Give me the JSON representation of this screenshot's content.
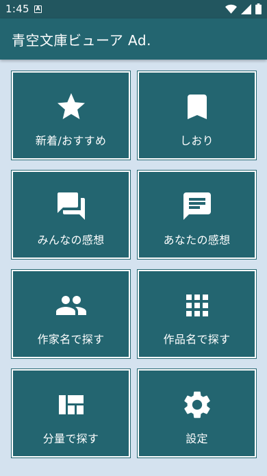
{
  "status_bar": {
    "time": "1:45",
    "notification_glyph": "A"
  },
  "app_bar": {
    "title": "青空文庫ビューア Ad."
  },
  "tiles": [
    {
      "label": "新着/おすすめ",
      "icon": "star-icon"
    },
    {
      "label": "しおり",
      "icon": "bookmark-icon"
    },
    {
      "label": "みんなの感想",
      "icon": "forum-icon"
    },
    {
      "label": "あなたの感想",
      "icon": "comment-icon"
    },
    {
      "label": "作家名で探す",
      "icon": "people-icon"
    },
    {
      "label": "作品名で探す",
      "icon": "grid-icon"
    },
    {
      "label": "分量で探す",
      "icon": "dashboard-icon"
    },
    {
      "label": "設定",
      "icon": "gear-icon"
    }
  ],
  "colors": {
    "background": "#d4e2ef",
    "primary": "#236570",
    "status_bar": "#22565f"
  }
}
